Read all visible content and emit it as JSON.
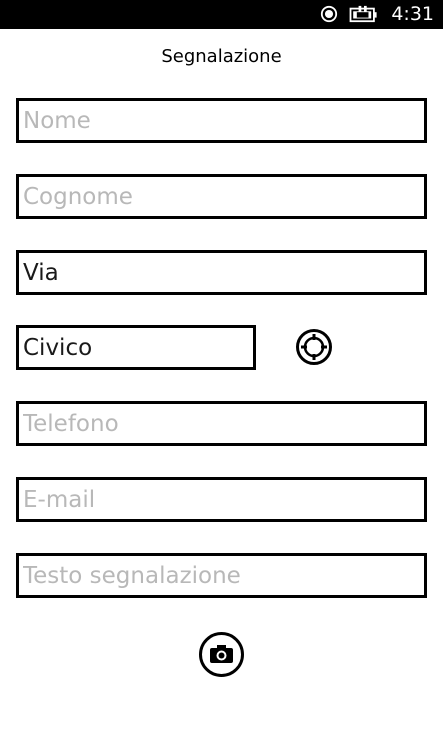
{
  "status_bar": {
    "time": "4:31",
    "icons": [
      "location-icon",
      "battery-charging-icon"
    ],
    "background": "#000000"
  },
  "page": {
    "title": "Segnalazione"
  },
  "form": {
    "nome": {
      "placeholder": "Nome",
      "value": ""
    },
    "cognome": {
      "placeholder": "Cognome",
      "value": ""
    },
    "via": {
      "placeholder": "Via",
      "value": "Via"
    },
    "civico": {
      "placeholder": "Civico",
      "value": "Civico"
    },
    "telefono": {
      "placeholder": "Telefono",
      "value": ""
    },
    "email": {
      "placeholder": "E-mail",
      "value": ""
    },
    "testo": {
      "placeholder": "Testo segnalazione",
      "value": ""
    }
  },
  "buttons": {
    "locate": {
      "icon": "crosshair-target-icon"
    },
    "camera": {
      "icon": "camera-icon"
    }
  }
}
